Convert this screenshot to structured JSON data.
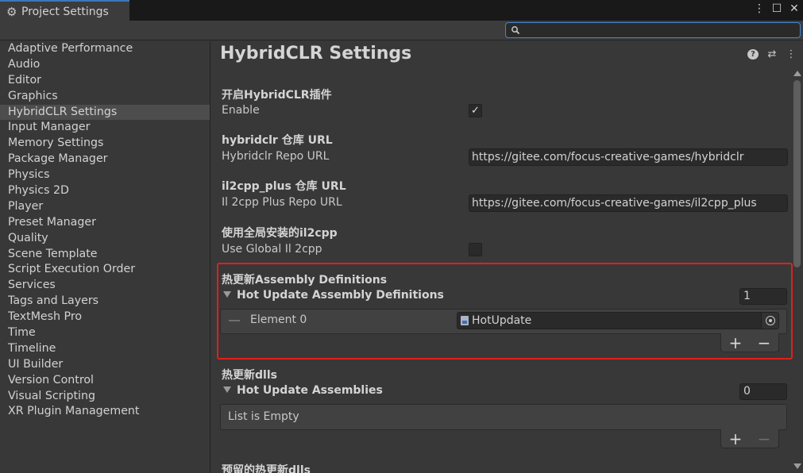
{
  "window": {
    "tab_title": "Project Settings",
    "icons": [
      "gear-icon",
      "kebab-menu-icon",
      "maximize-icon",
      "close-icon"
    ]
  },
  "search": {
    "placeholder": "",
    "value": ""
  },
  "sidebar": {
    "items": [
      {
        "label": "Adaptive Performance",
        "selected": false
      },
      {
        "label": "Audio",
        "selected": false
      },
      {
        "label": "Editor",
        "selected": false
      },
      {
        "label": "Graphics",
        "selected": false
      },
      {
        "label": "HybridCLR Settings",
        "selected": true
      },
      {
        "label": "Input Manager",
        "selected": false
      },
      {
        "label": "Memory Settings",
        "selected": false
      },
      {
        "label": "Package Manager",
        "selected": false
      },
      {
        "label": "Physics",
        "selected": false
      },
      {
        "label": "Physics 2D",
        "selected": false
      },
      {
        "label": "Player",
        "selected": false
      },
      {
        "label": "Preset Manager",
        "selected": false
      },
      {
        "label": "Quality",
        "selected": false
      },
      {
        "label": "Scene Template",
        "selected": false
      },
      {
        "label": "Script Execution Order",
        "selected": false
      },
      {
        "label": "Services",
        "selected": false
      },
      {
        "label": "Tags and Layers",
        "selected": false
      },
      {
        "label": "TextMesh Pro",
        "selected": false
      },
      {
        "label": "Time",
        "selected": false
      },
      {
        "label": "Timeline",
        "selected": false
      },
      {
        "label": "UI Builder",
        "selected": false
      },
      {
        "label": "Version Control",
        "selected": false
      },
      {
        "label": "Visual Scripting",
        "selected": false
      },
      {
        "label": "XR Plugin Management",
        "selected": false
      }
    ]
  },
  "main": {
    "title": "HybridCLR Settings",
    "header_icons": [
      "help-icon",
      "preset-sliders-icon",
      "kebab-menu-icon"
    ],
    "enable": {
      "section": "开启HybridCLR插件",
      "label": "Enable",
      "checked": true,
      "check_glyph": "✓"
    },
    "repo_url": {
      "section": "hybridclr 仓库 URL",
      "label": "Hybridclr Repo URL",
      "value": "https://gitee.com/focus-creative-games/hybridclr"
    },
    "il2cpp_url": {
      "section": "il2cpp_plus 仓库 URL",
      "label": "Il 2cpp Plus Repo URL",
      "value": "https://gitee.com/focus-creative-games/il2cpp_plus"
    },
    "global_il2cpp": {
      "section": "使用全局安装的il2cpp",
      "label": "Use Global Il 2cpp",
      "checked": false
    },
    "hot_update_asm_defs": {
      "section": "热更新Assembly Definitions",
      "foldout": "Hot Update Assembly Definitions",
      "size": "1",
      "elements": [
        {
          "label": "Element 0",
          "value": "HotUpdate"
        }
      ],
      "add": "+",
      "remove": "−"
    },
    "hot_update_dlls": {
      "section": "热更新dlls",
      "foldout": "Hot Update Assemblies",
      "size": "0",
      "empty_text": "List is Empty",
      "add": "+",
      "remove": "−"
    },
    "reserved_dlls": {
      "section": "预留的热更新dlls"
    }
  },
  "colors": {
    "highlight": "#e0201c",
    "focus": "#3f86d3",
    "selected": "#4d4d4d"
  }
}
